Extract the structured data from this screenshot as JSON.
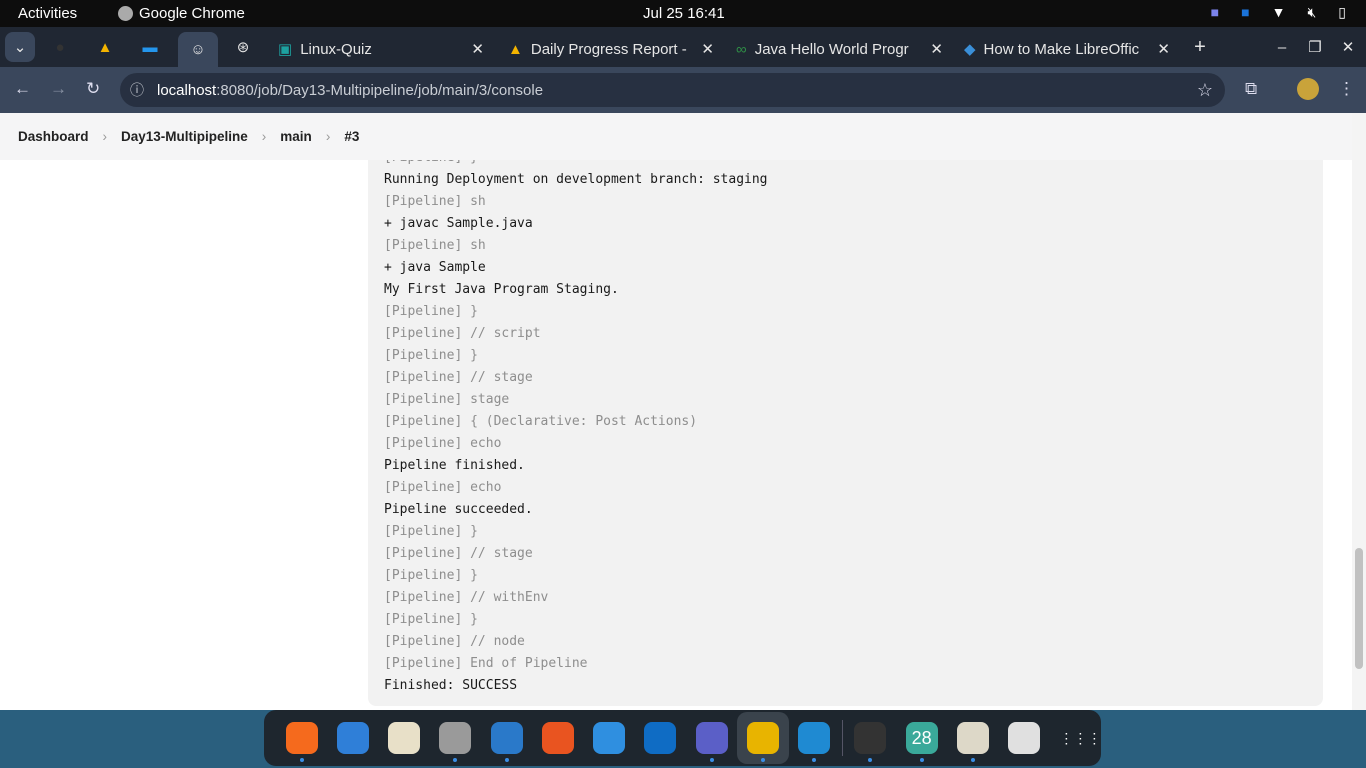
{
  "system": {
    "activities": "Activities",
    "app_name": "Google Chrome",
    "clock": "Jul 25  16:41"
  },
  "tabs": [
    {
      "title": "Linux-Quiz"
    },
    {
      "title": "Daily Progress Report -"
    },
    {
      "title": "Java Hello World Progr"
    },
    {
      "title": "How to Make LibreOffic"
    }
  ],
  "omnibox": {
    "host": "localhost",
    "path": ":8080/job/Day13-Multipipeline/job/main/3/console"
  },
  "breadcrumb": [
    "Dashboard",
    "Day13-Multipipeline",
    "main",
    "#3"
  ],
  "console": [
    {
      "t": "[Pipeline] }",
      "dim": true
    },
    {
      "t": "Running Deployment on development branch: staging",
      "dim": false
    },
    {
      "t": "[Pipeline] sh",
      "dim": true
    },
    {
      "t": "+ javac Sample.java",
      "dim": false
    },
    {
      "t": "[Pipeline] sh",
      "dim": true
    },
    {
      "t": "+ java Sample",
      "dim": false
    },
    {
      "t": "My First Java Program Staging.",
      "dim": false
    },
    {
      "t": "[Pipeline] }",
      "dim": true
    },
    {
      "t": "[Pipeline] // script",
      "dim": true
    },
    {
      "t": "[Pipeline] }",
      "dim": true
    },
    {
      "t": "[Pipeline] // stage",
      "dim": true
    },
    {
      "t": "[Pipeline] stage",
      "dim": true
    },
    {
      "t": "[Pipeline] { (Declarative: Post Actions)",
      "dim": true
    },
    {
      "t": "[Pipeline] echo",
      "dim": true
    },
    {
      "t": "Pipeline finished.",
      "dim": false
    },
    {
      "t": "[Pipeline] echo",
      "dim": true
    },
    {
      "t": "Pipeline succeeded.",
      "dim": false
    },
    {
      "t": "[Pipeline] }",
      "dim": true
    },
    {
      "t": "[Pipeline] // stage",
      "dim": true
    },
    {
      "t": "[Pipeline] }",
      "dim": true
    },
    {
      "t": "[Pipeline] // withEnv",
      "dim": true
    },
    {
      "t": "[Pipeline] }",
      "dim": true
    },
    {
      "t": "[Pipeline] // node",
      "dim": true
    },
    {
      "t": "[Pipeline] End of Pipeline",
      "dim": true
    },
    {
      "t": "Finished: SUCCESS",
      "dim": false
    }
  ],
  "dock": [
    {
      "name": "firefox",
      "color": "#f56a1d",
      "running": true
    },
    {
      "name": "thunderbird",
      "color": "#2f7fd8",
      "running": false
    },
    {
      "name": "rhythmbox",
      "color": "#e8e0c8",
      "running": false
    },
    {
      "name": "files",
      "color": "#9a9a9a",
      "running": true
    },
    {
      "name": "libreoffice-writer",
      "color": "#2a79c9",
      "running": true
    },
    {
      "name": "app-center",
      "color": "#e95420",
      "running": false
    },
    {
      "name": "help",
      "color": "#2f8fe0",
      "running": false
    },
    {
      "name": "outlook",
      "color": "#0f6cc4",
      "running": false
    },
    {
      "name": "teams",
      "color": "#5b5fc7",
      "running": true
    },
    {
      "name": "chrome",
      "color": "#e8b400",
      "running": true,
      "active": true
    },
    {
      "name": "vscode",
      "color": "#1f8ad2",
      "running": true
    },
    {
      "name": "terminal",
      "color": "#333",
      "running": true
    },
    {
      "name": "calendar",
      "color": "#3aa99a",
      "running": true,
      "label": "28"
    },
    {
      "name": "image-viewer",
      "color": "#ddd8c8",
      "running": true
    },
    {
      "name": "trash",
      "color": "#e0e0e0",
      "running": false
    },
    {
      "name": "show-apps",
      "color": "#1e262e",
      "running": false
    }
  ]
}
